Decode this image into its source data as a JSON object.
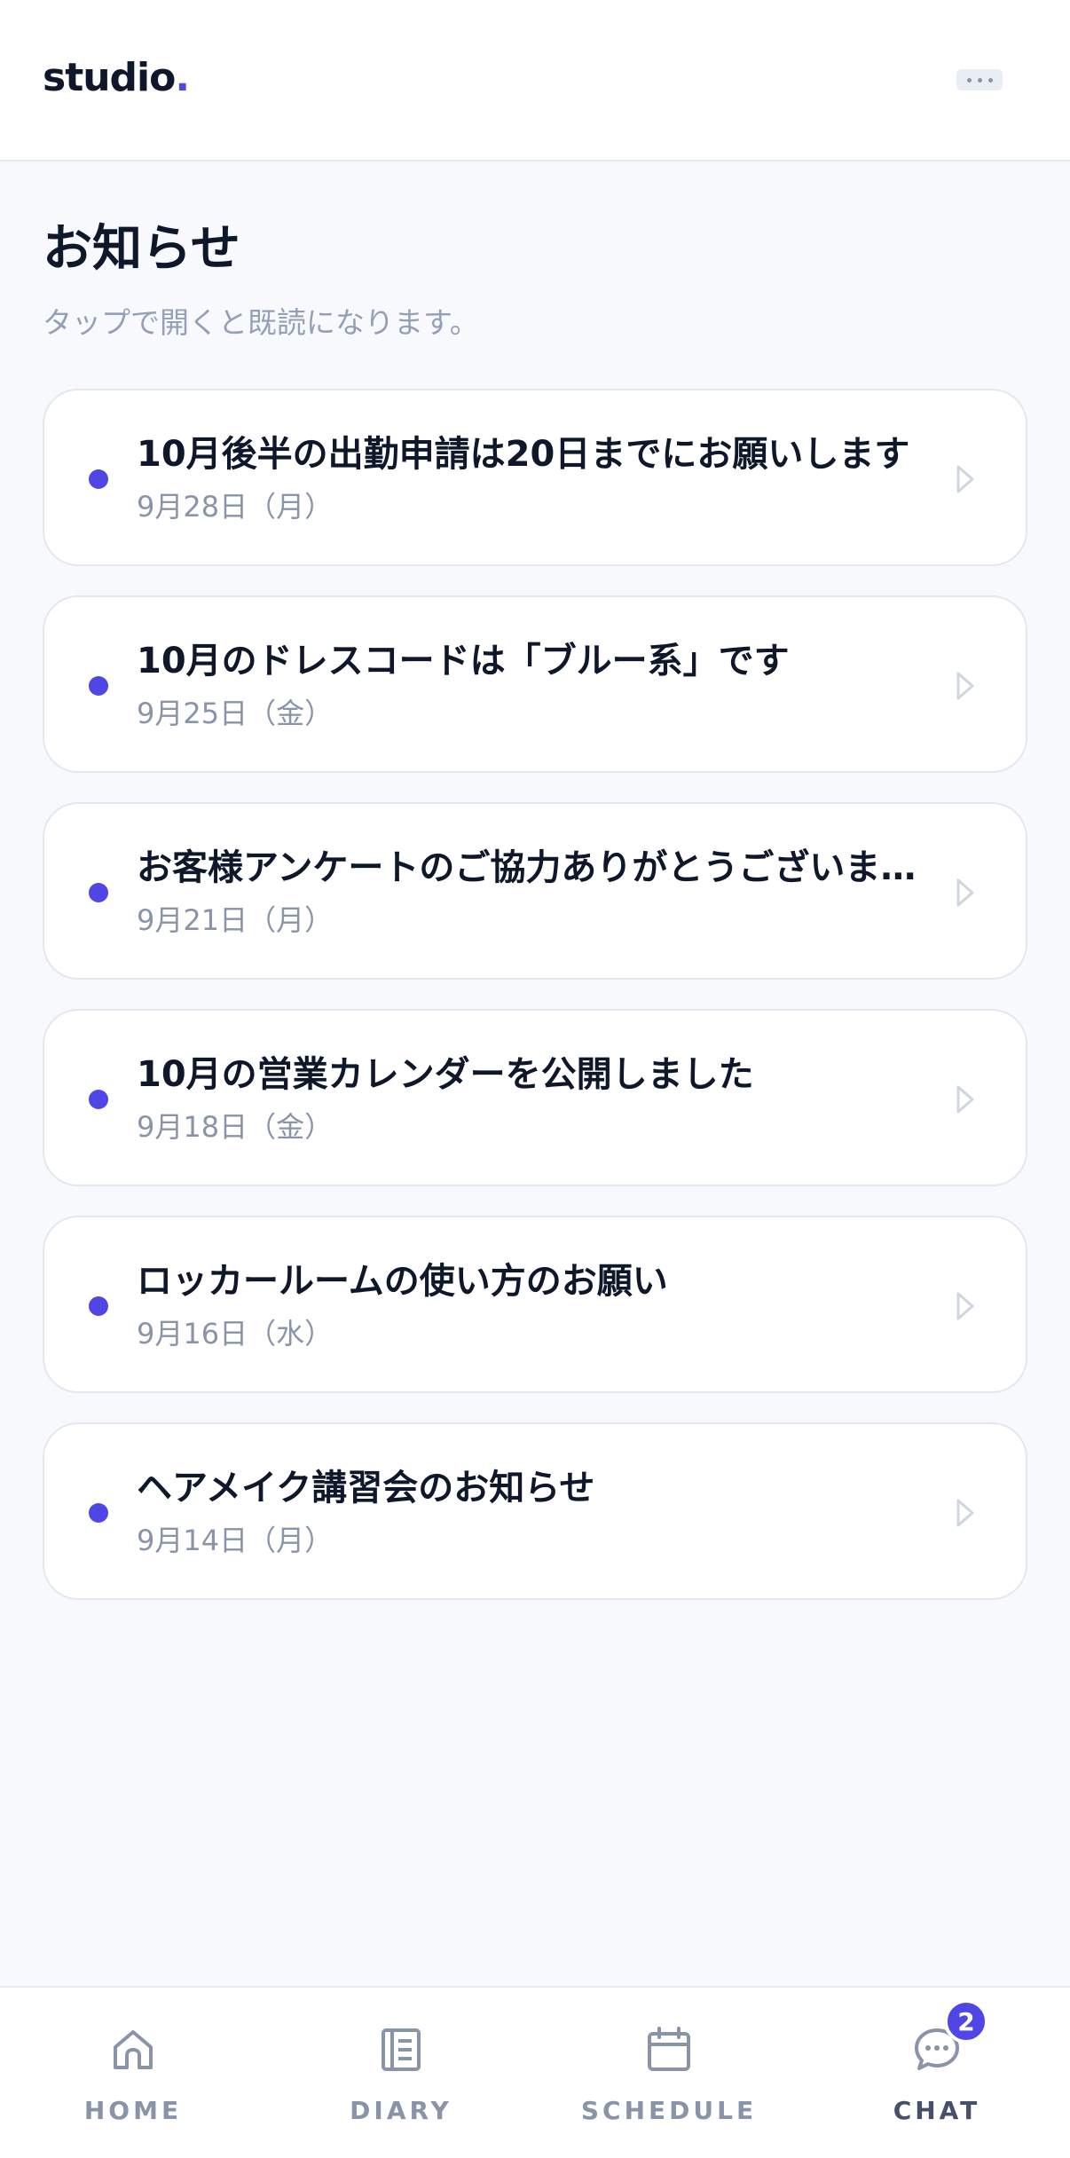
{
  "header": {
    "logo_text": "studio",
    "logo_dot": ".",
    "more_icon": "more-horizontal-icon"
  },
  "page": {
    "title": "お知らせ",
    "subtitle": "タップで開くと既読になります。"
  },
  "notices": [
    {
      "title": "10月後半の出勤申請は20日までにお願いします",
      "date": "9月28日（月）",
      "unread": true
    },
    {
      "title": "10月のドレスコードは「ブルー系」です",
      "date": "9月25日（金）",
      "unread": true
    },
    {
      "title": "お客様アンケートのご協力ありがとうございま…",
      "date": "9月21日（月）",
      "unread": true
    },
    {
      "title": "10月の営業カレンダーを公開しました",
      "date": "9月18日（金）",
      "unread": true
    },
    {
      "title": "ロッカールームの使い方のお願い",
      "date": "9月16日（水）",
      "unread": true
    },
    {
      "title": "ヘアメイク講習会のお知らせ",
      "date": "9月14日（月）",
      "unread": true
    }
  ],
  "nav": {
    "items": [
      {
        "label": "HOME",
        "icon": "home-icon"
      },
      {
        "label": "DIARY",
        "icon": "notebook-icon"
      },
      {
        "label": "SCHEDULE",
        "icon": "calendar-icon"
      },
      {
        "label": "CHAT",
        "icon": "chat-bubble-icon",
        "active": true
      }
    ],
    "chat_badge": "2"
  },
  "colors": {
    "accent": "#5046e5",
    "background": "#f8f9fc",
    "muted_text": "#8a94a8"
  }
}
